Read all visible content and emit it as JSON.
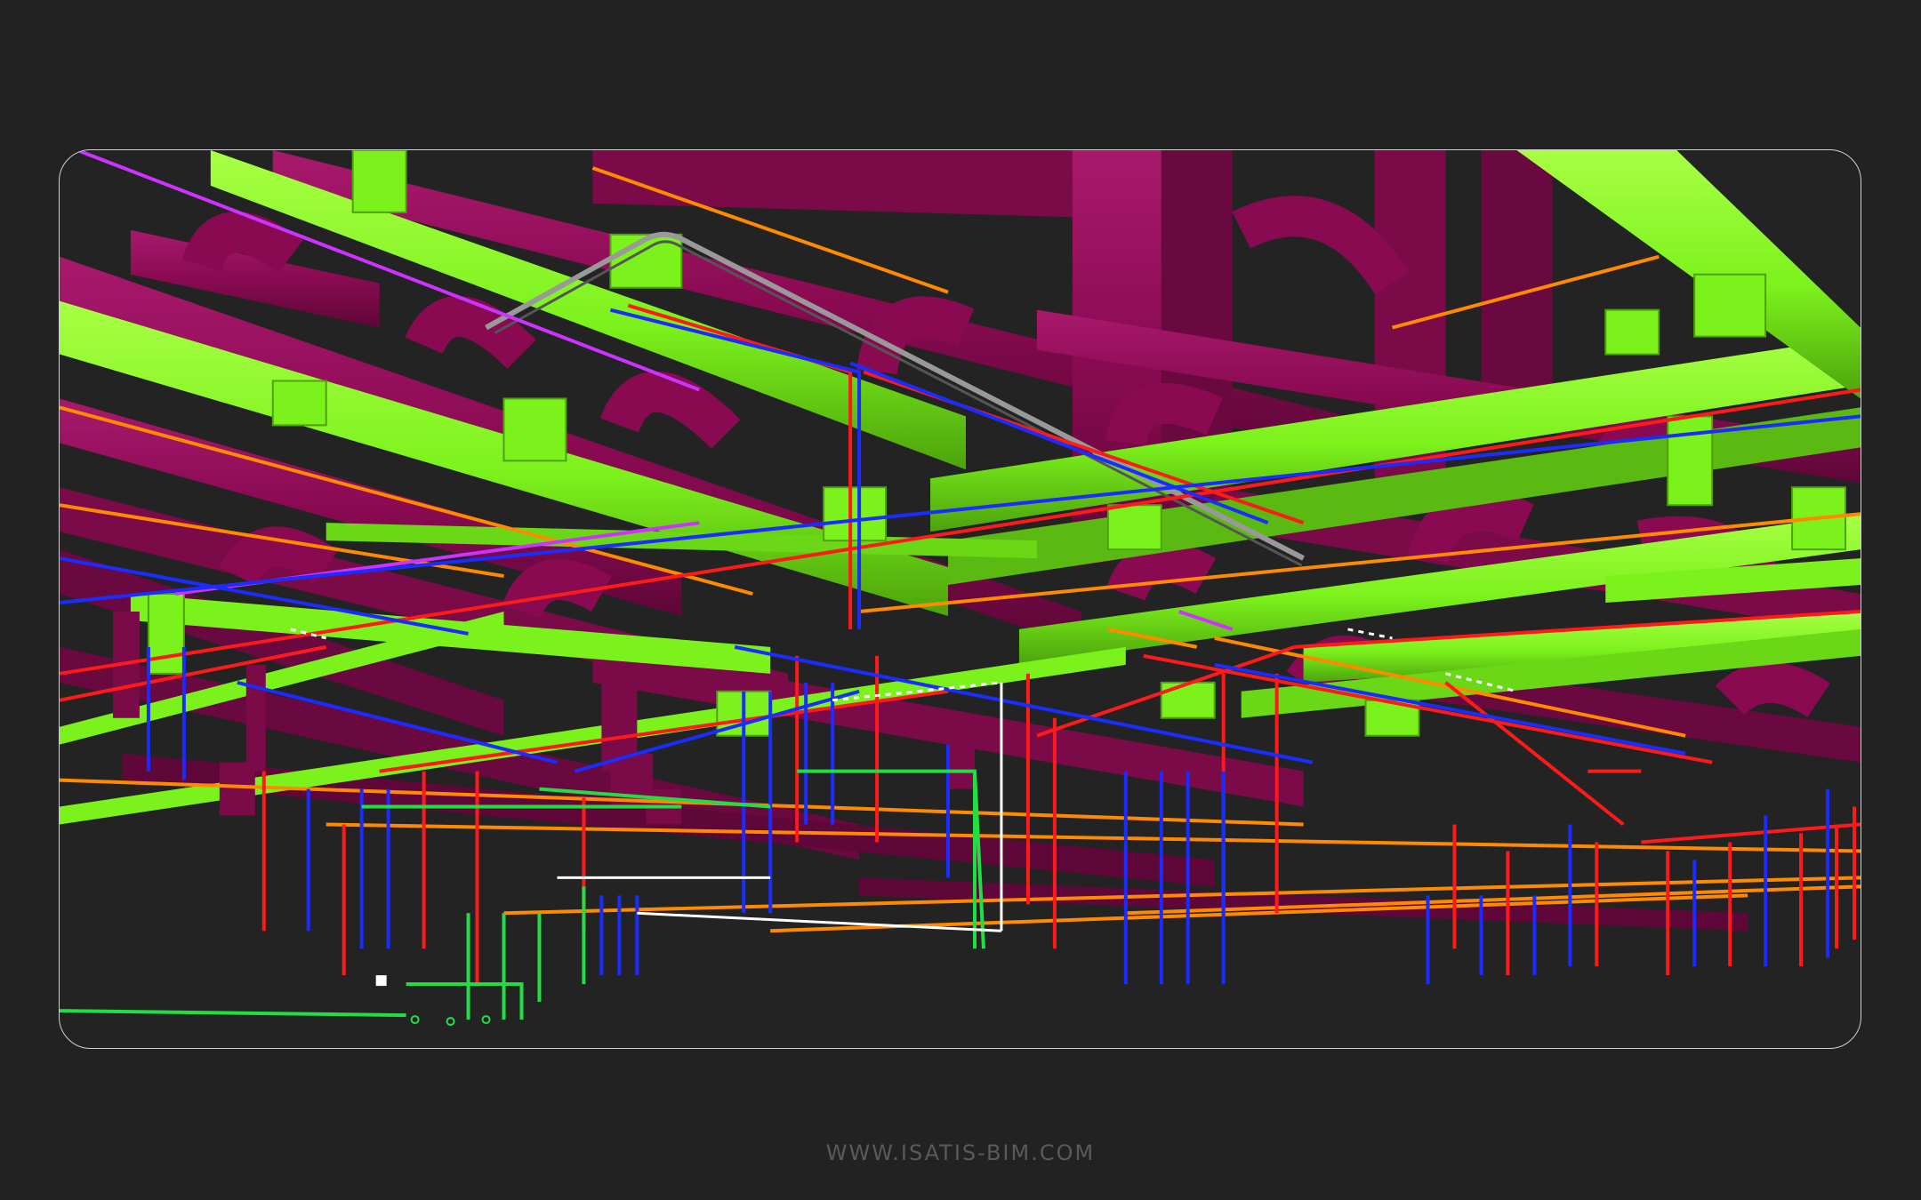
{
  "footer": {
    "url": "WWW.ISATIS-BIM.COM"
  },
  "render": {
    "background": "#222222",
    "frame_border": "#cfcfcf",
    "colors": {
      "hvac_duct": "#8a0a52",
      "hvac_duct_dark": "#5e0738",
      "hvac_duct_light": "#a8196c",
      "supply_duct": "#7cf21c",
      "supply_duct_dark": "#4da30c",
      "supply_duct_light": "#a8ff44",
      "hot_water_pipe": "#ff1a1a",
      "cold_water_pipe": "#1a2cff",
      "gas_pipe": "#ff8a00",
      "drain_pipe": "#22dd44",
      "electrical_tray": "#cc33ff",
      "conduit": "#bbbbbb",
      "white_pipe": "#ffffff"
    }
  }
}
